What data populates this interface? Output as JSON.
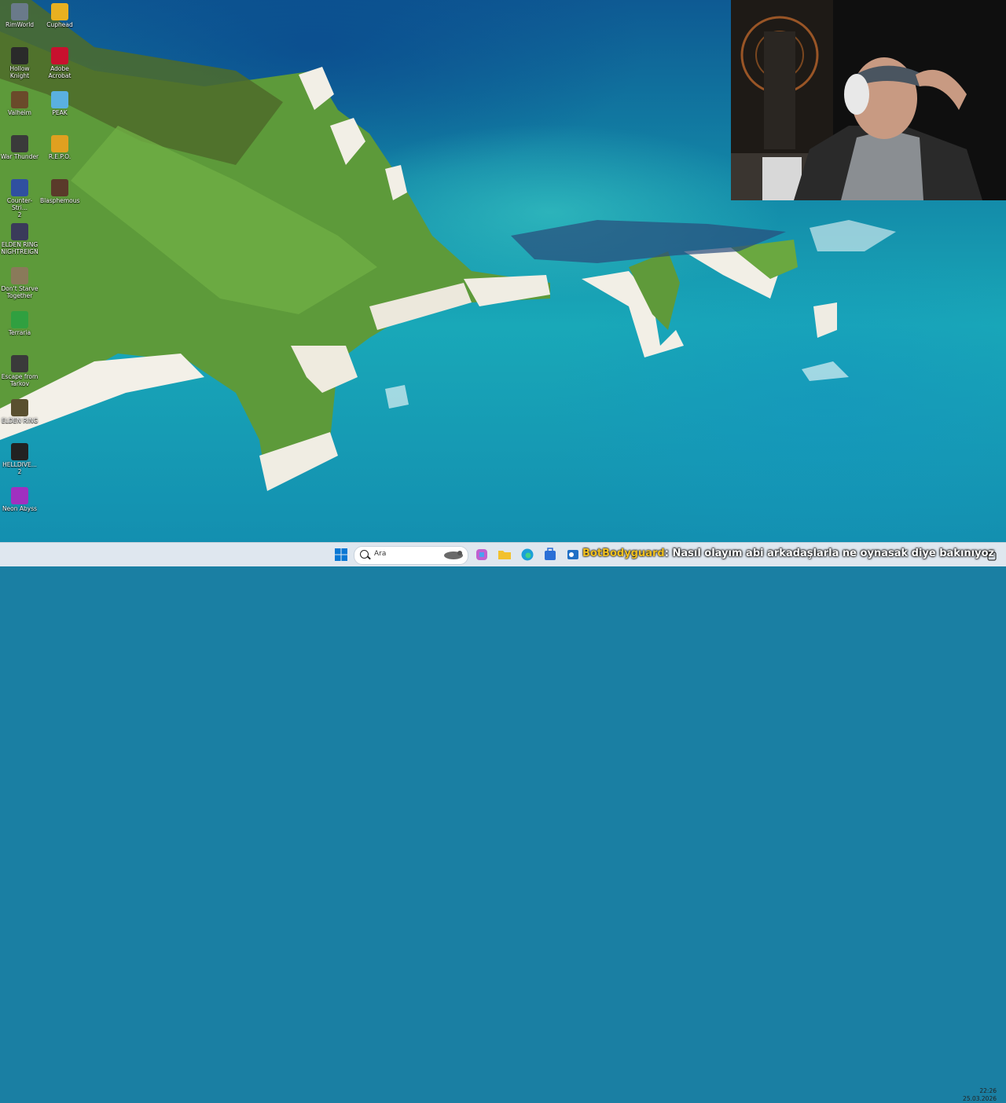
{
  "desktop": {
    "icons": [
      {
        "label": "RimWorld",
        "icon": "rimworld-icon",
        "color": "#6a7a8a"
      },
      {
        "label": "Cuphead",
        "icon": "cuphead-icon",
        "color": "#e8b020"
      },
      {
        "label": "Hollow\nKnight",
        "icon": "hollow-knight-icon",
        "color": "#2a2a2a"
      },
      {
        "label": "Adobe\nAcrobat",
        "icon": "adobe-acrobat-icon",
        "color": "#c8102e"
      },
      {
        "label": "Valheim",
        "icon": "valheim-icon",
        "color": "#6a4a2a"
      },
      {
        "label": "PEAK",
        "icon": "peak-icon",
        "color": "#5ab0e0"
      },
      {
        "label": "War Thunder",
        "icon": "war-thunder-icon",
        "color": "#3a3a3a"
      },
      {
        "label": "R.E.P.O.",
        "icon": "repo-icon",
        "color": "#e0a020"
      },
      {
        "label": "Counter-Stri...\n2",
        "icon": "counter-strike-2-icon",
        "color": "#3050a0"
      },
      {
        "label": "Blasphemous",
        "icon": "blasphemous-icon",
        "color": "#5a3a2a"
      },
      {
        "label": "ELDEN RING\nNIGHTREIGN",
        "icon": "elden-ring-nightreign-icon",
        "color": "#3a3a5a"
      },
      {
        "label": "Don't Starve\nTogether",
        "icon": "dont-starve-together-icon",
        "color": "#8a7a5a"
      },
      {
        "label": "Terraria",
        "icon": "terraria-icon",
        "color": "#30a040"
      },
      {
        "label": "Escape from\nTarkov",
        "icon": "escape-from-tarkov-icon",
        "color": "#3a3a3a"
      },
      {
        "label": "ELDEN RING",
        "icon": "elden-ring-icon",
        "color": "#5a5030"
      },
      {
        "label": "HELLDIVE...\n2",
        "icon": "helldivers-2-icon",
        "color": "#222222"
      },
      {
        "label": "Neon Abyss",
        "icon": "neon-abyss-icon",
        "color": "#a030c0"
      }
    ]
  },
  "taskbar": {
    "search_placeholder": "Ara",
    "apps": [
      {
        "icon": "start-icon",
        "color": "#0a78d4"
      },
      {
        "icon": "copilot-icon",
        "color": "#c060d0"
      },
      {
        "icon": "file-explorer-icon",
        "color": "#f2c12e"
      },
      {
        "icon": "edge-icon",
        "color": "#1ba0d8"
      },
      {
        "icon": "store-icon",
        "color": "#2b6fd6"
      },
      {
        "icon": "outlook-icon",
        "color": "#1f6fc5"
      }
    ],
    "clock": {
      "time": "22:26",
      "date": "25.03.2026"
    }
  },
  "chat_overlay": {
    "username": "BotBodyguard",
    "separator": ":",
    "message": "Nasıl olayım abi arkadaşlarla ne oynasak diye bakınıyoz"
  },
  "colors": {
    "username": "#f0c020",
    "taskbar": "#dfe7ef"
  }
}
